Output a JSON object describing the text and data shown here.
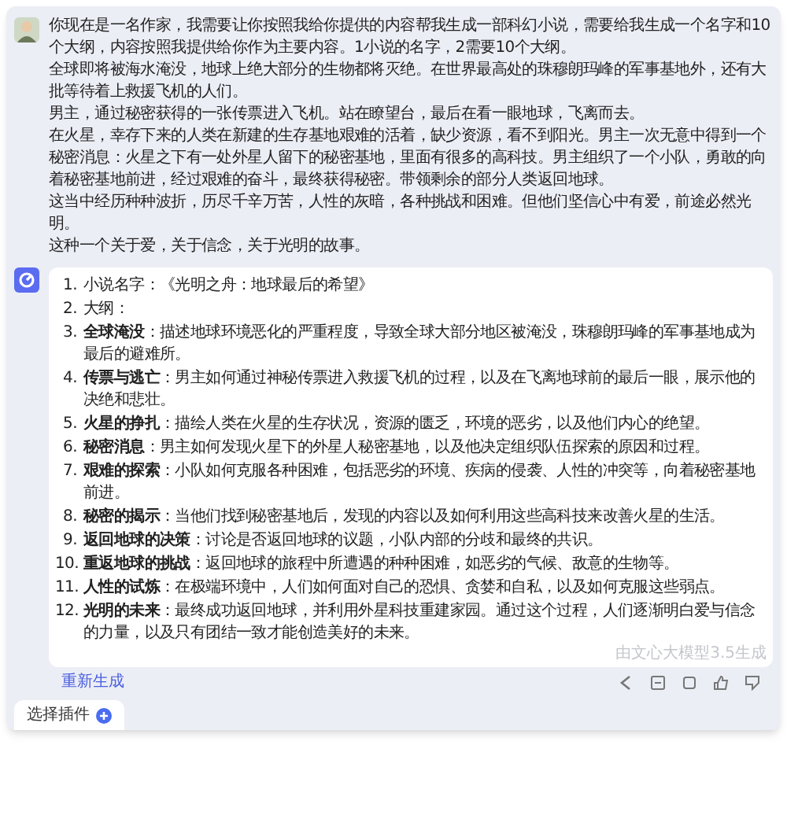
{
  "prompt": {
    "paragraphs": [
      "你现在是一名作家，我需要让你按照我给你提供的内容帮我生成一部科幻小说，需要给我生成一个名字和10个大纲，内容按照我提供给你作为主要内容。1小说的名字，2需要10个大纲。",
      "全球即将被海水淹没，地球上绝大部分的生物都将灭绝。在世界最高处的珠穆朗玛峰的军事基地外，还有大批等待着上救援飞机的人们。",
      "男主，通过秘密获得的一张传票进入飞机。站在瞭望台，最后在看一眼地球，飞离而去。",
      "在火星，幸存下来的人类在新建的生存基地艰难的活着，缺少资源，看不到阳光。男主一次无意中得到一个秘密消息：火星之下有一处外星人留下的秘密基地，里面有很多的高科技。男主组织了一个小队，勇敢的向着秘密基地前进，经过艰难的奋斗，最终获得秘密。带领剩余的部分人类返回地球。",
      "这当中经历种种波折，历尽千辛万苦，人性的灰暗，各种挑战和困难。但他们坚信心中有爱，前途必然光明。",
      "这种一个关于爱，关于信念，关于光明的故事。"
    ]
  },
  "answer": {
    "items": [
      {
        "number": "1.",
        "text": "小说名字：《光明之舟：地球最后的希望》"
      },
      {
        "number": "2.",
        "text": "大纲："
      },
      {
        "number": "3.",
        "text": "**全球淹没**：描述地球环境恶化的严重程度，导致全球大部分地区被淹没，珠穆朗玛峰的军事基地成为最后的避难所。"
      },
      {
        "number": "4.",
        "text": "**传票与逃亡**：男主如何通过神秘传票进入救援飞机的过程，以及在飞离地球前的最后一眼，展示他的决绝和悲壮。"
      },
      {
        "number": "5.",
        "text": "**火星的挣扎**：描绘人类在火星的生存状况，资源的匮乏，环境的恶劣，以及他们内心的绝望。"
      },
      {
        "number": "6.",
        "text": "**秘密消息**：男主如何发现火星下的外星人秘密基地，以及他决定组织队伍探索的原因和过程。"
      },
      {
        "number": "7.",
        "text": "**艰难的探索**：小队如何克服各种困难，包括恶劣的环境、疾病的侵袭、人性的冲突等，向着秘密基地前进。"
      },
      {
        "number": "8.",
        "text": "**秘密的揭示**：当他们找到秘密基地后，发现的内容以及如何利用这些高科技来改善火星的生活。"
      },
      {
        "number": "9.",
        "text": "**返回地球的决策**：讨论是否返回地球的议题，小队内部的分歧和最终的共识。"
      },
      {
        "number": "10.",
        "text": "**重返地球的挑战**：返回地球的旅程中所遭遇的种种困难，如恶劣的气候、敌意的生物等。"
      },
      {
        "number": "11.",
        "text": "**人性的试炼**：在极端环境中，人们如何面对自己的恐惧、贪婪和自私，以及如何克服这些弱点。"
      },
      {
        "number": "12.",
        "text": "**光明的未来**：最终成功返回地球，并利用外星科技重建家园。通过这个过程，人们逐渐明白爱与信念的力量，以及只有团结一致才能创造美好的未来。"
      }
    ],
    "footnote": "由文心大模型3.5生成"
  },
  "regenerate_link": "重新生成",
  "plugin_button": "选择插件"
}
